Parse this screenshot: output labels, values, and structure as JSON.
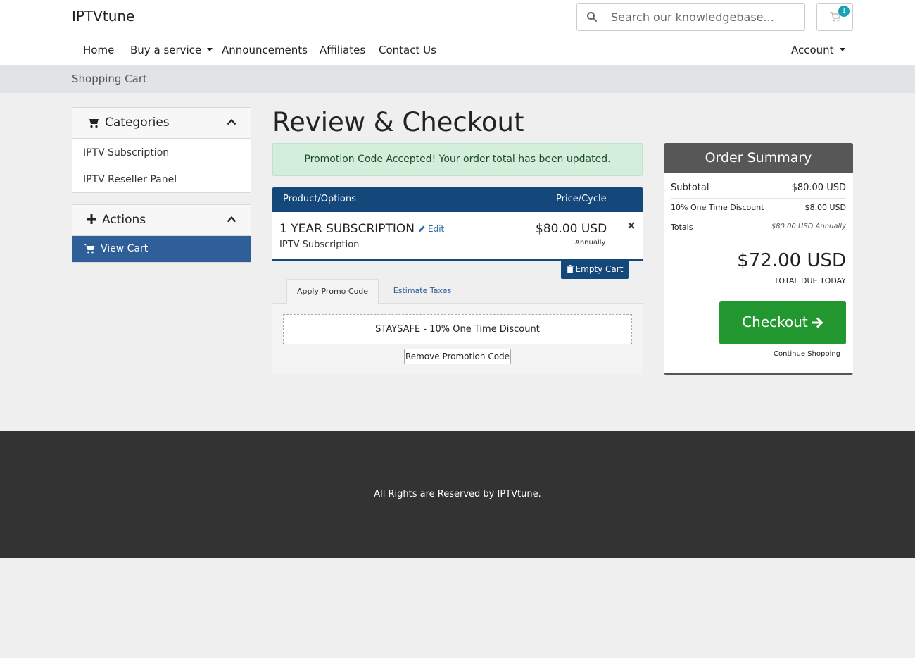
{
  "header": {
    "brand": "IPTVtune",
    "search_placeholder": "Search our knowledgebase...",
    "cart_count": "1"
  },
  "nav": {
    "items": [
      "Home",
      "Buy a service",
      "Announcements",
      "Affiliates",
      "Contact Us"
    ],
    "account": "Account"
  },
  "breadcrumb": "Shopping Cart",
  "sidebar": {
    "categories": {
      "title": "Categories",
      "items": [
        "IPTV Subscription",
        "IPTV Reseller Panel"
      ]
    },
    "actions": {
      "title": "Actions",
      "items": [
        "View Cart"
      ]
    }
  },
  "main": {
    "title": "Review & Checkout",
    "alert": "Promotion Code Accepted! Your order total has been updated.",
    "table": {
      "headers": [
        "Product/Options",
        "Price/Cycle"
      ],
      "rows": [
        {
          "name": "1 YEAR SUBSCRIPTION",
          "edit": "Edit",
          "group": "IPTV Subscription",
          "price": "$80.00 USD",
          "cycle": "Annually"
        }
      ]
    },
    "empty_cart": "Empty Cart",
    "tabs": [
      "Apply Promo Code",
      "Estimate Taxes"
    ],
    "promo_applied": "STAYSAFE - 10% One Time Discount",
    "remove_promo": "Remove Promotion Code"
  },
  "summary": {
    "title": "Order Summary",
    "subtotal_label": "Subtotal",
    "subtotal_value": "$80.00 USD",
    "discount_label": "10% One Time Discount",
    "discount_value": "$8.00 USD",
    "totals_label": "Totals",
    "totals_value": "$80.00 USD Annually",
    "total_due": "$72.00 USD",
    "total_due_label": "TOTAL DUE TODAY",
    "checkout": "Checkout",
    "continue": "Continue Shopping"
  },
  "footer": {
    "text": "All Rights are Reserved by IPTVtune."
  },
  "colors": {
    "primary": "#15487a",
    "active_sidebar": "#2f5f99",
    "checkout_green": "#22962f",
    "alert_bg": "#d3eedb",
    "summary_header": "#575757",
    "footer_bg": "#333333"
  }
}
